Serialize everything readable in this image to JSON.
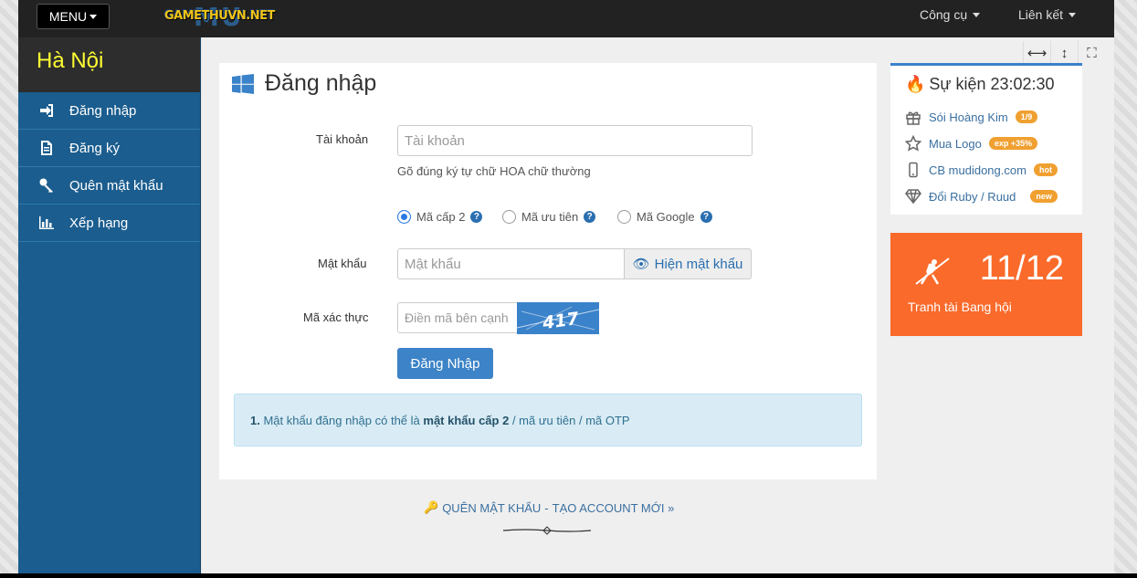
{
  "topbar": {
    "menu_label": "MENU",
    "logo_main": "MU",
    "logo_sub": "GAMETHUVN.NET",
    "nav": [
      "Công cụ",
      "Liên kết"
    ]
  },
  "sidebar": {
    "city": "Hà Nội",
    "items": [
      {
        "label": "Đăng nhập",
        "icon": "sign-in-icon"
      },
      {
        "label": "Đăng ký",
        "icon": "file-icon"
      },
      {
        "label": "Quên mật khẩu",
        "icon": "key-icon"
      },
      {
        "label": "Xếp hạng",
        "icon": "bar-chart-icon"
      }
    ]
  },
  "login": {
    "title": "Đăng nhập",
    "account_label": "Tài khoản",
    "account_placeholder": "Tài khoản",
    "account_help": "Gõ đúng ký tự chữ HOA chữ thường",
    "radios": [
      {
        "label": "Mã cấp 2",
        "checked": true
      },
      {
        "label": "Mã ưu tiên",
        "checked": false
      },
      {
        "label": "Mã Google",
        "checked": false
      }
    ],
    "password_label": "Mật khẩu",
    "password_placeholder": "Mật khẩu",
    "show_password": "Hiện mật khẩu",
    "captcha_label": "Mã xác thực",
    "captcha_placeholder": "Điền mã bên cạnh",
    "captcha_text": "417",
    "submit": "Đăng Nhập",
    "notice_num": "1.",
    "notice_pre": "Mật khẩu đăng nhập có thể là",
    "notice_bold": "mật khẩu cấp 2",
    "notice_post": "/ mã ưu tiên / mã OTP"
  },
  "footer": {
    "forgot": "QUÊN MẬT KHẨU",
    "sep": "-",
    "create": "TẠO ACCOUNT MỚI »"
  },
  "events": {
    "title": "Sự kiện 23:02:30",
    "items": [
      {
        "label": "Sói Hoàng Kim",
        "badge": "1/9",
        "icon": "gift-icon"
      },
      {
        "label": "Mua Logo",
        "badge": "exp +35%",
        "icon": "star-icon"
      },
      {
        "label": "CB mudidong.com",
        "badge": "hot",
        "icon": "mobile-icon"
      },
      {
        "label": "Đổi Ruby / Ruud",
        "badge": "new",
        "icon": "diamond-icon"
      }
    ]
  },
  "promo": {
    "number": "11/12",
    "label": "Tranh tài Bang hội",
    "color": "#fa6a2a"
  }
}
